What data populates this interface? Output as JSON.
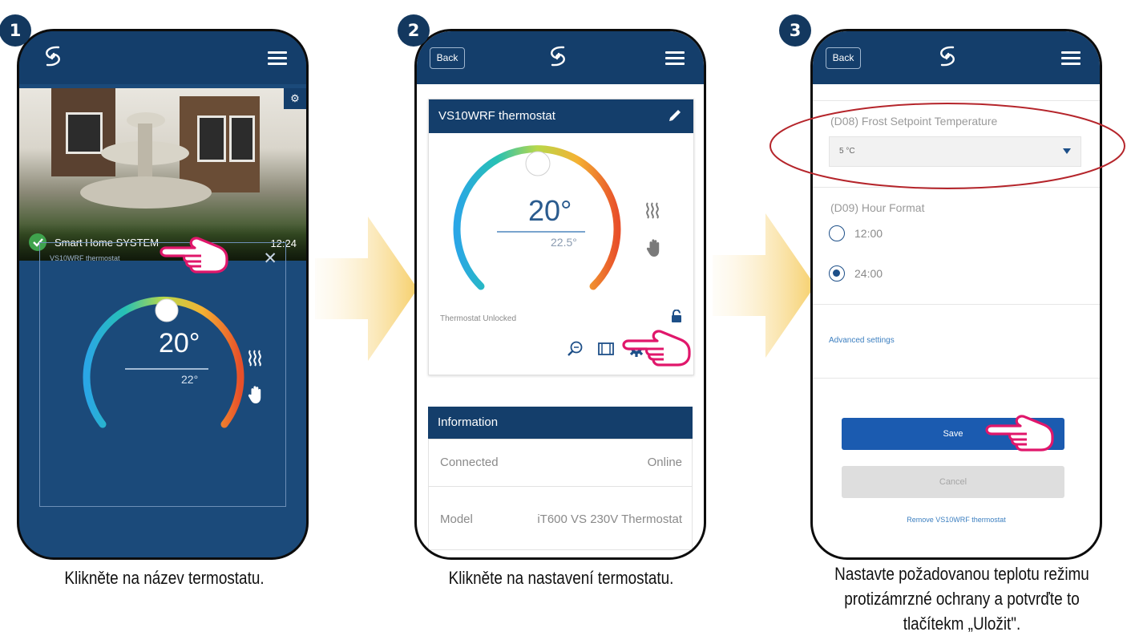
{
  "steps": [
    {
      "number": "1",
      "caption": "Klikněte na název termostatu."
    },
    {
      "number": "2",
      "caption": "Klikněte na nastavení termostatu."
    },
    {
      "number": "3",
      "caption": "Nastavte požadovanou teplotu režimu protizámrzné ochrany a potvrďte to tlačítekm „Uložit\"."
    }
  ],
  "screen1": {
    "gear_icon": "⚙",
    "photo_label": "Smart Home SYSTEM",
    "photo_time": "12:24",
    "card_title": "VS10WRF thermostat",
    "close_icon": "✕",
    "setpoint": "20°",
    "current_temp": "22°"
  },
  "screen2": {
    "back_label": "Back",
    "panel_title": "VS10WRF thermostat",
    "setpoint": "20°",
    "current_temp": "22.5°",
    "status": "Thermostat Unlocked",
    "info_title": "Information",
    "info_rows": [
      {
        "key": "Connected",
        "value": "Online"
      },
      {
        "key": "Model",
        "value": "iT600 VS 230V Thermostat"
      }
    ]
  },
  "screen3": {
    "back_label": "Back",
    "frost_label": "(D08) Frost Setpoint Temperature",
    "frost_value": "5 °C",
    "hour_label": "(D09) Hour Format",
    "hour_options": [
      "12:00",
      "24:00"
    ],
    "hour_selected": "24:00",
    "advanced_link": "Advanced settings",
    "save_label": "Save",
    "cancel_label": "Cancel",
    "remove_link": "Remove VS10WRF thermostat"
  },
  "colors": {
    "navy": "#143e6b",
    "dark_screen": "#1b4a7a",
    "primary_button": "#1b5bb0",
    "arrow": "#f6cf6a",
    "highlight_circle": "#b5252b",
    "hand_outline": "#e0176b"
  },
  "icons": [
    "salus-logo-icon",
    "hamburger-menu-icon",
    "gear-icon",
    "close-icon",
    "heating-icon",
    "manual-hand-icon",
    "pencil-icon",
    "lock-icon",
    "zoom-icon",
    "window-icon",
    "hand-pointer-icon",
    "arrow-right-icon"
  ]
}
